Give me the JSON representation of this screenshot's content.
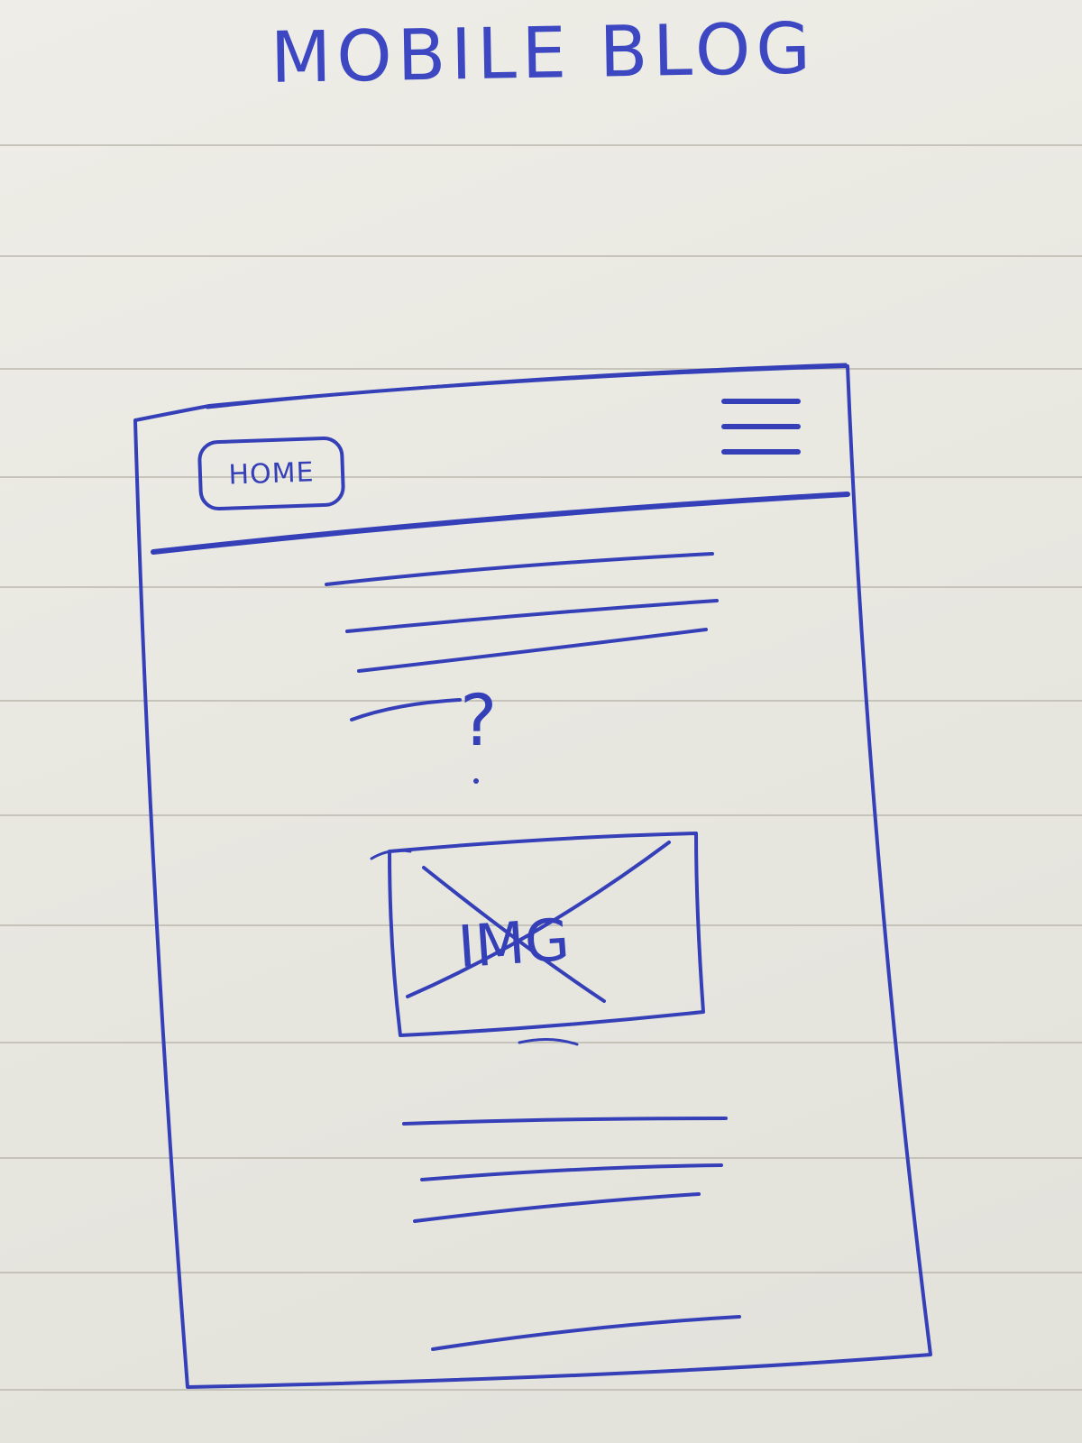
{
  "sketch": {
    "title": "MOBILE BLOG"
  },
  "header": {
    "home_label": "HOME",
    "menu_icon": "hamburger-menu-icon"
  },
  "content": {
    "question_mark": "?",
    "image_placeholder_text": "IMG",
    "image_placeholder_icon": "crossed-image-placeholder-icon"
  },
  "colors": {
    "ink": "#3540b8",
    "paper": "#ecebe5",
    "rule": "#b9b7ae"
  }
}
